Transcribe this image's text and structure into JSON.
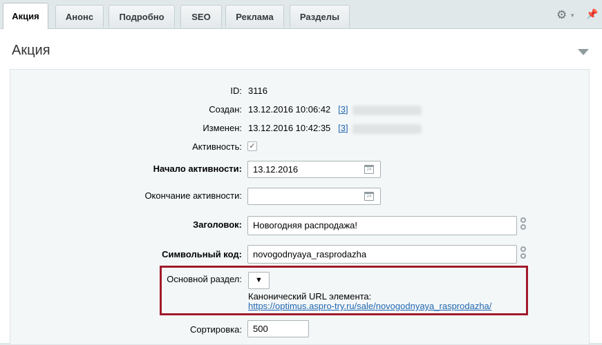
{
  "tabs": [
    "Акция",
    "Анонс",
    "Подробно",
    "SEO",
    "Реклама",
    "Разделы"
  ],
  "icons": {
    "settings": "gear-icon",
    "pin": "pin-icon"
  },
  "panel": {
    "title": "Акция"
  },
  "fields": {
    "id": {
      "label": "ID:",
      "value": "3116"
    },
    "created": {
      "label": "Создан:",
      "value": "13.12.2016 10:06:42",
      "user_link": "[3]"
    },
    "modified": {
      "label": "Изменен:",
      "value": "13.12.2016 10:42:35",
      "user_link": "[3]"
    },
    "active": {
      "label": "Активность:",
      "checked": true
    },
    "active_from": {
      "label": "Начало активности:",
      "value": "13.12.2016"
    },
    "active_to": {
      "label": "Окончание активности:",
      "value": ""
    },
    "name": {
      "label": "Заголовок:",
      "value": "Новогодняя распродажа!"
    },
    "code": {
      "label": "Символьный код:",
      "value": "novogodnyaya_rasprodazha"
    },
    "section": {
      "label": "Основной раздел:",
      "selected": "",
      "canonical_label": "Канонический URL элемента:",
      "canonical_url": "https://optimus.aspro-try.ru/sale/novogodnyaya_rasprodazha/"
    },
    "sort": {
      "label": "Сортировка:",
      "value": "500"
    }
  },
  "colors": {
    "highlight": "#a01a2a",
    "link": "#2067b0"
  }
}
